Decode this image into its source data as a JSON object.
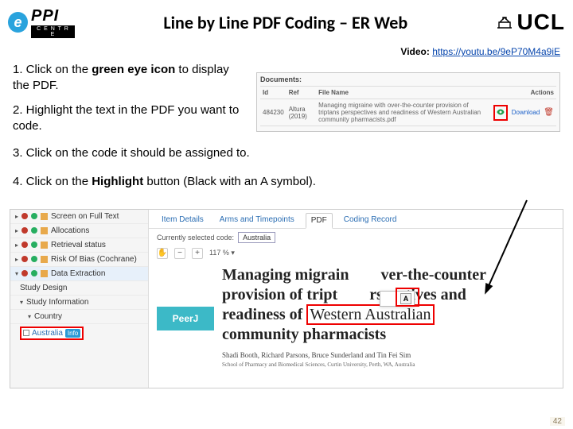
{
  "header": {
    "logo_e": "e",
    "logo_ppi": "PPI",
    "logo_centre": "C E N T R E",
    "title": "Line by Line PDF Coding – ER Web",
    "ucl": "UCL"
  },
  "video": {
    "label": "Video: ",
    "url_text": "https://youtu.be/9eP70M4a9iE",
    "url_href": "https://youtu.be/9eP70M4a9iE"
  },
  "steps": {
    "s1_pre": "1.  Click on the ",
    "s1_bold": "green eye icon",
    "s1_post": " to display the PDF.",
    "s2": "2.  Highlight the text in the PDF you want to code.",
    "s3": "3.   Click on the code it should be assigned to.",
    "s4_pre": "4.   Click on the ",
    "s4_bold": "Highlight",
    "s4_post": " button (Black with an A symbol)."
  },
  "docpanel": {
    "header": "Documents:",
    "cols": {
      "id": "Id",
      "ref": "Ref",
      "fn": "File Name",
      "actions": "Actions"
    },
    "row": {
      "id": "484230",
      "ref": "Altura (2019)",
      "fn": "Managing migraine with over-the-counter provision of triptans perspectives and readiness of Western Australian community pharmacists.pdf",
      "download": "Download"
    }
  },
  "sidebar": {
    "screen": "Screen on Full Text",
    "alloc": "Allocations",
    "retr": "Retrieval status",
    "rob": "Risk Of Bias (Cochrane)",
    "de": "Data Extraction",
    "sd": "Study Design",
    "si": "Study Information",
    "country": "Country",
    "aus": "Australia",
    "info": "Info"
  },
  "tabs": {
    "t1": "Item Details",
    "t2": "Arms and Timepoints",
    "t3": "PDF",
    "t4": "Coding Record"
  },
  "selcode": {
    "label": "Currently selected code:",
    "chip": "Australia"
  },
  "toolbar": {
    "zoom": "117 % ▾",
    "a_btn": "A"
  },
  "paper": {
    "peerj": "PeerJ",
    "title_1": "Managing migrain",
    "title_2": "ver-the-counter",
    "title_3": "provision of tript",
    "title_4": "rspectives and",
    "title_5": "readiness of ",
    "title_wa": "Western Australian",
    "title_6": "community pharmacists",
    "authors": "Shadi Booth, Richard Parsons, Bruce Sunderland and Tin Fei Sim",
    "affil": "School of Pharmacy and Biomedical Sciences, Curtin University, Perth, WA, Australia"
  },
  "slide_number": "42"
}
